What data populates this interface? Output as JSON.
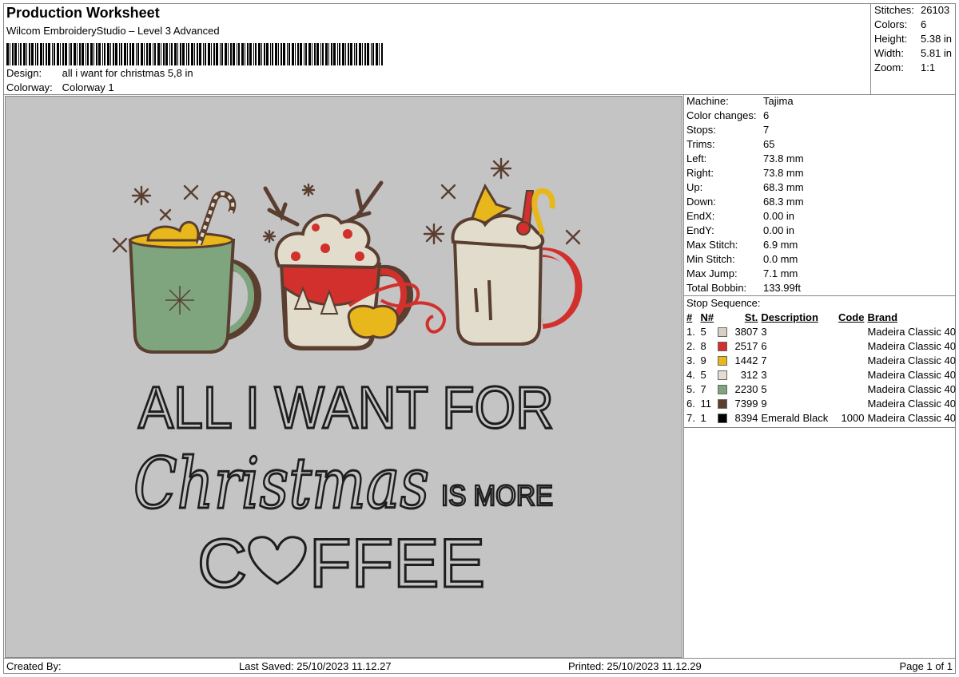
{
  "header": {
    "title": "Production Worksheet",
    "app": "Wilcom EmbroideryStudio – Level 3 Advanced",
    "design_label": "Design:",
    "design_value": "all i want for christmas 5,8 in",
    "colorway_label": "Colorway:",
    "colorway_value": "Colorway 1"
  },
  "summary": [
    {
      "label": "Stitches:",
      "value": "26103"
    },
    {
      "label": "Colors:",
      "value": "6"
    },
    {
      "label": "Height:",
      "value": "5.38 in"
    },
    {
      "label": "Width:",
      "value": "5.81 in"
    },
    {
      "label": "Zoom:",
      "value": "1:1"
    }
  ],
  "properties": [
    {
      "label": "Machine:",
      "value": "Tajima"
    },
    {
      "label": "Color changes:",
      "value": "6"
    },
    {
      "label": "Stops:",
      "value": "7"
    },
    {
      "label": "Trims:",
      "value": "65"
    },
    {
      "label": "Left:",
      "value": "73.8 mm"
    },
    {
      "label": "Right:",
      "value": "73.8 mm"
    },
    {
      "label": "Up:",
      "value": "68.3 mm"
    },
    {
      "label": "Down:",
      "value": "68.3 mm"
    },
    {
      "label": "EndX:",
      "value": "0.00 in"
    },
    {
      "label": "EndY:",
      "value": "0.00 in"
    },
    {
      "label": "Max Stitch:",
      "value": "6.9 mm"
    },
    {
      "label": "Min Stitch:",
      "value": "0.0 mm"
    },
    {
      "label": "Max Jump:",
      "value": "7.1 mm"
    },
    {
      "label": "Total Bobbin:",
      "value": "133.99ft"
    }
  ],
  "stop_sequence": {
    "label": "Stop Sequence:",
    "headers": [
      "#",
      "N#",
      "St.",
      "Description",
      "Code",
      "Brand"
    ],
    "rows": [
      {
        "idx": "1.",
        "n": "5",
        "color": "#d9cfc2",
        "st": "3807",
        "desc": "3",
        "code": "",
        "brand": "Madeira Classic 40"
      },
      {
        "idx": "2.",
        "n": "8",
        "color": "#d2302c",
        "st": "2517",
        "desc": "6",
        "code": "",
        "brand": "Madeira Classic 40"
      },
      {
        "idx": "3.",
        "n": "9",
        "color": "#e8b71c",
        "st": "1442",
        "desc": "7",
        "code": "",
        "brand": "Madeira Classic 40"
      },
      {
        "idx": "4.",
        "n": "5",
        "color": "#e6dcd2",
        "st": "312",
        "desc": "3",
        "code": "",
        "brand": "Madeira Classic 40"
      },
      {
        "idx": "5.",
        "n": "7",
        "color": "#7fa57e",
        "st": "2230",
        "desc": "5",
        "code": "",
        "brand": "Madeira Classic 40"
      },
      {
        "idx": "6.",
        "n": "11",
        "color": "#5a3e30",
        "st": "7399",
        "desc": "9",
        "code": "",
        "brand": "Madeira Classic 40"
      },
      {
        "idx": "7.",
        "n": "1",
        "color": "#000000",
        "st": "8394",
        "desc": "Emerald Black",
        "code": "1000",
        "brand": "Madeira Classic 40"
      }
    ]
  },
  "artwork": {
    "line1": "ALL I WANT FOR",
    "line2": "Christmas",
    "line2b": "IS MORE",
    "line3a": "C",
    "line3b": "FFEE"
  },
  "footer": {
    "created_by": "Created By:",
    "last_saved": "Last Saved: 25/10/2023 11.12.27",
    "printed": "Printed: 25/10/2023 11.12.29",
    "page": "Page 1 of 1"
  },
  "colors": {
    "panel_bg": "#c4c4c4",
    "mug_green": "#7fa57e",
    "outline_brown": "#5a3e30",
    "red": "#d2302c",
    "gold": "#e8b71c",
    "cream": "#e2dccd"
  }
}
